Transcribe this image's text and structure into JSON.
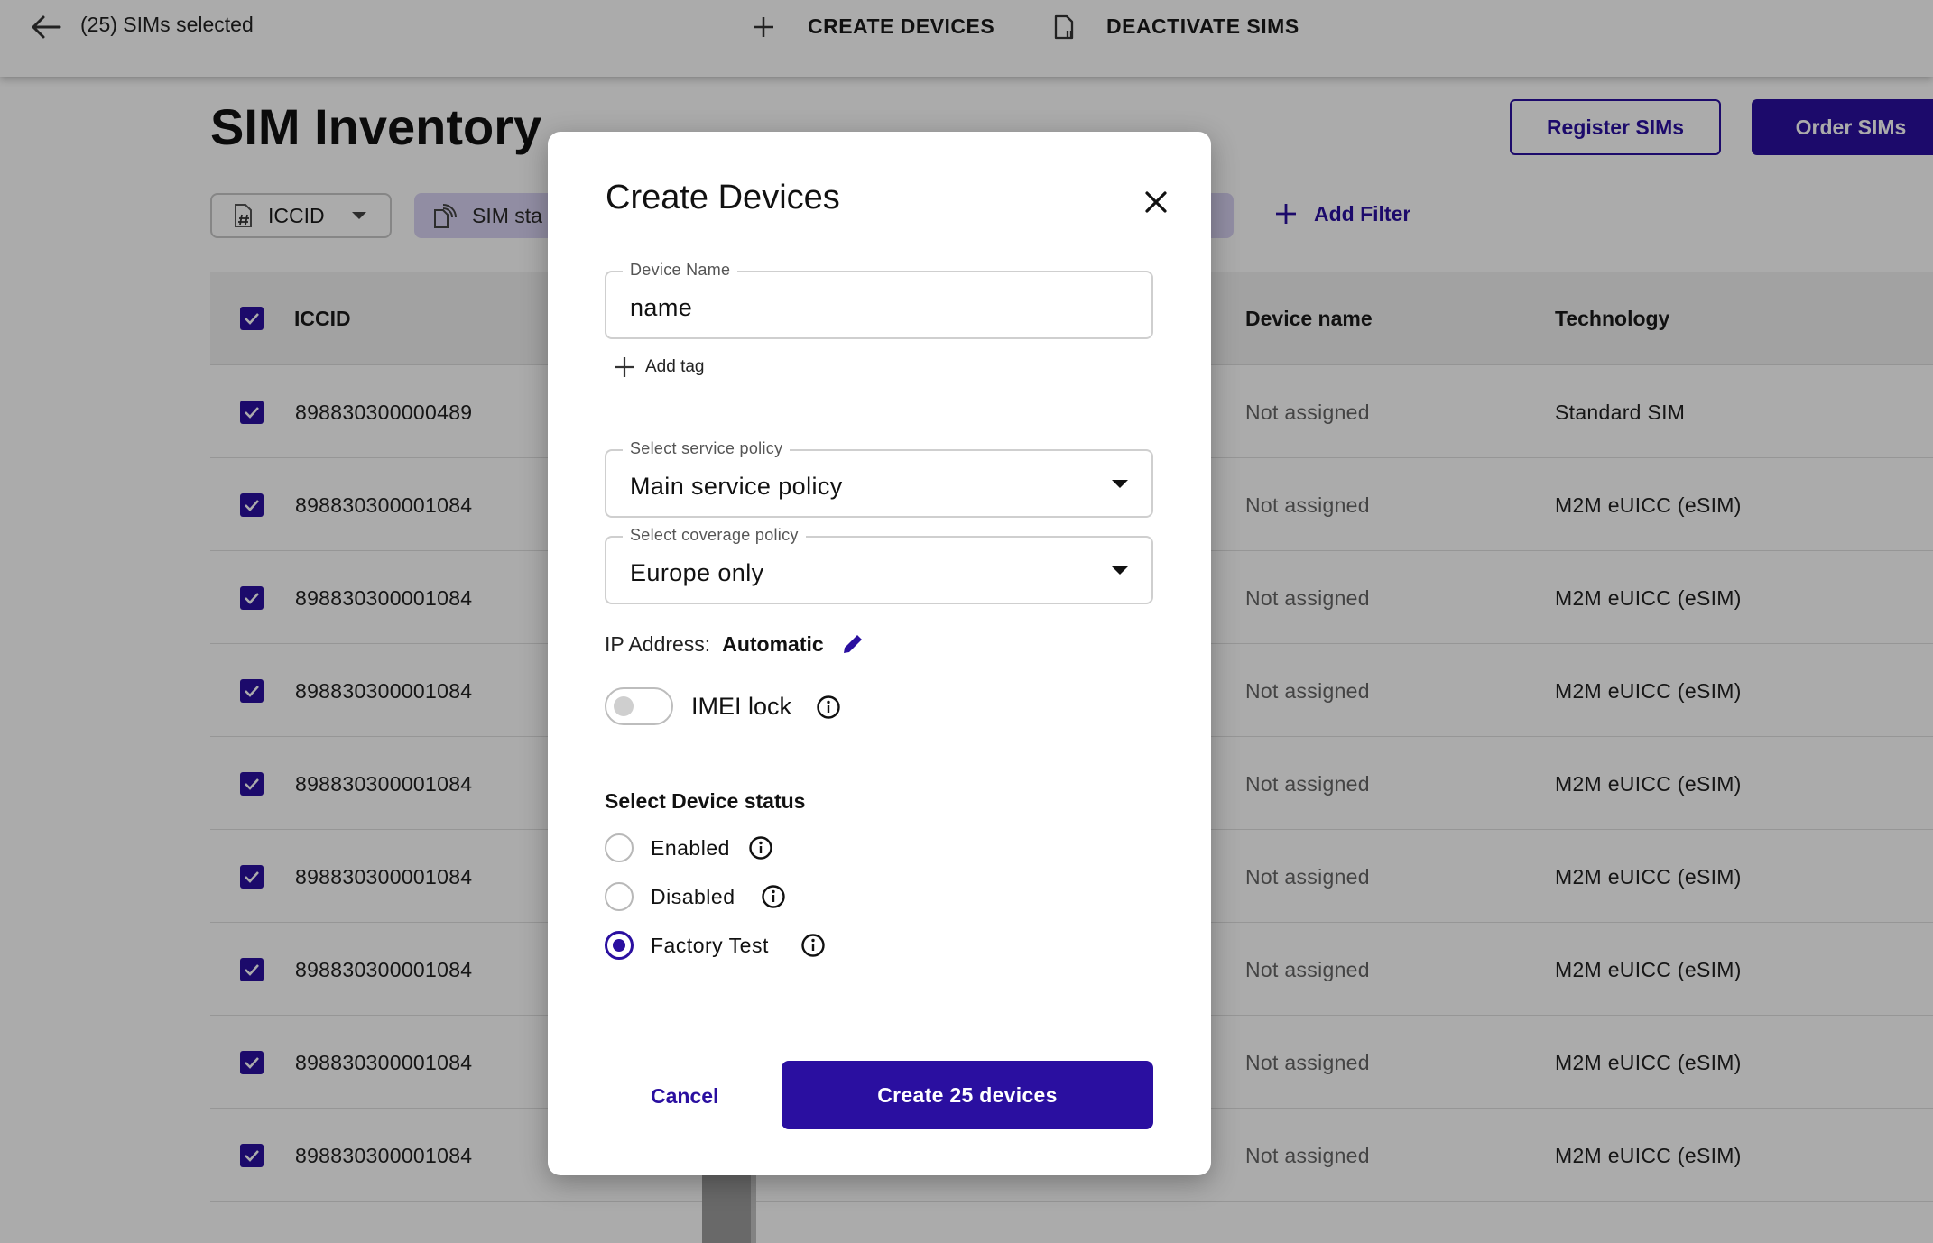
{
  "topbar": {
    "selected_text": "(25) SIMs selected",
    "actions": [
      {
        "label": "CREATE DEVICES",
        "icon": "plus-icon"
      },
      {
        "label": "DEACTIVATE SIMS",
        "icon": "sim-deactivate-icon"
      }
    ]
  },
  "page": {
    "title": "SIM Inventory",
    "register_label": "Register SIMs",
    "order_label": "Order SIMs"
  },
  "filters": {
    "iccid_label": "ICCID",
    "status_label": "SIM sta",
    "add_filter_label": "Add Filter"
  },
  "table": {
    "columns": [
      "ICCID",
      "Device name",
      "Technology"
    ],
    "rows": [
      {
        "iccid": "898830300000489",
        "device": "Not assigned",
        "tech": "Standard SIM"
      },
      {
        "iccid": "898830300001084",
        "device": "Not assigned",
        "tech": "M2M eUICC (eSIM)"
      },
      {
        "iccid": "898830300001084",
        "device": "Not assigned",
        "tech": "M2M eUICC (eSIM)"
      },
      {
        "iccid": "898830300001084",
        "device": "Not assigned",
        "tech": "M2M eUICC (eSIM)"
      },
      {
        "iccid": "898830300001084",
        "device": "Not assigned",
        "tech": "M2M eUICC (eSIM)"
      },
      {
        "iccid": "898830300001084",
        "device": "Not assigned",
        "tech": "M2M eUICC (eSIM)"
      },
      {
        "iccid": "898830300001084",
        "device": "Not assigned",
        "tech": "M2M eUICC (eSIM)"
      },
      {
        "iccid": "898830300001084",
        "device": "Not assigned",
        "tech": "M2M eUICC (eSIM)"
      },
      {
        "iccid": "898830300001084",
        "device": "Not assigned",
        "tech": "M2M eUICC (eSIM)"
      }
    ]
  },
  "modal": {
    "title": "Create Devices",
    "device_name_label": "Device Name",
    "device_name_value": "name",
    "add_tag_label": "Add tag",
    "service_policy_label": "Select service policy",
    "service_policy_value": "Main service policy",
    "coverage_policy_label": "Select coverage policy",
    "coverage_policy_value": "Europe only",
    "ip_label": "IP Address:",
    "ip_value": "Automatic",
    "imei_label": "IMEI lock",
    "imei_lock_on": false,
    "status_heading": "Select Device status",
    "status_options": [
      {
        "label": "Enabled",
        "selected": false
      },
      {
        "label": "Disabled",
        "selected": false
      },
      {
        "label": "Factory Test",
        "selected": true
      }
    ],
    "cancel_label": "Cancel",
    "create_label": "Create 25 devices"
  },
  "colors": {
    "accent": "#2a0fa0",
    "chip": "#d9d2f3"
  }
}
